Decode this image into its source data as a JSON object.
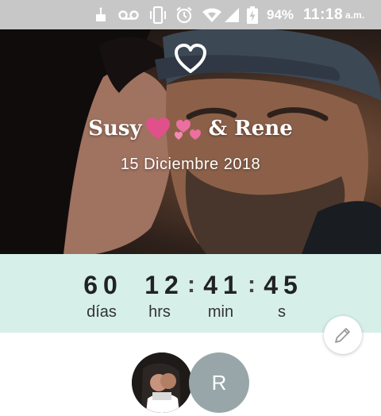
{
  "status_bar": {
    "battery_percent": "94%",
    "time": "11:18",
    "ampm": "a.m.",
    "icons": [
      "cake-icon",
      "voicemail-icon",
      "vibrate-icon",
      "alarm-icon",
      "wifi-icon",
      "signal-icon",
      "battery-charging-icon"
    ]
  },
  "event": {
    "names_left": "Susy",
    "names_right": "& Rene",
    "date": "15 Diciembre 2018"
  },
  "countdown": {
    "days_value": "60",
    "hours_value": "12",
    "minutes_value": "41",
    "seconds_value": "45",
    "days_label": "días",
    "hours_label": "hrs",
    "minutes_label": "min",
    "seconds_label": "s",
    "separator": ":"
  },
  "guests": {
    "avatar_initial": "R"
  },
  "colors": {
    "status_bar": "#c7c7c7",
    "countdown_bg": "#d6efe9",
    "avatar_bg": "#98a6a9",
    "heart_emoji": "#e0508a"
  }
}
